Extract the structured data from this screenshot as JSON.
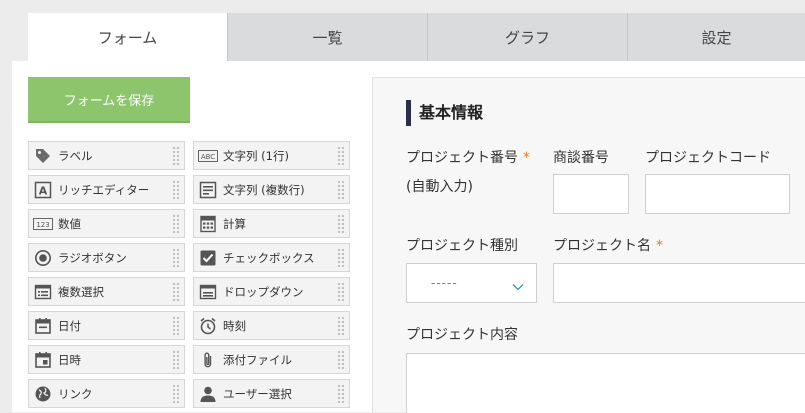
{
  "tabs": [
    {
      "label": "フォーム",
      "active": true
    },
    {
      "label": "一覧"
    },
    {
      "label": "グラフ"
    },
    {
      "label": "設定"
    }
  ],
  "palette": {
    "save_label": "フォームを保存",
    "items": [
      {
        "label": "ラベル",
        "icon": "tag-icon"
      },
      {
        "label": "文字列 (1行)",
        "icon": "abc-icon"
      },
      {
        "label": "リッチエディター",
        "icon": "rich-text-icon"
      },
      {
        "label": "文字列 (複数行)",
        "icon": "multiline-text-icon"
      },
      {
        "label": "数値",
        "icon": "number-icon"
      },
      {
        "label": "計算",
        "icon": "calculator-icon"
      },
      {
        "label": "ラジオボタン",
        "icon": "radio-icon"
      },
      {
        "label": "チェックボックス",
        "icon": "checkbox-icon"
      },
      {
        "label": "複数選択",
        "icon": "multi-select-icon"
      },
      {
        "label": "ドロップダウン",
        "icon": "dropdown-icon"
      },
      {
        "label": "日付",
        "icon": "calendar-icon"
      },
      {
        "label": "時刻",
        "icon": "clock-icon"
      },
      {
        "label": "日時",
        "icon": "datetime-icon"
      },
      {
        "label": "添付ファイル",
        "icon": "paperclip-icon"
      },
      {
        "label": "リンク",
        "icon": "globe-icon"
      },
      {
        "label": "ユーザー選択",
        "icon": "user-icon"
      }
    ]
  },
  "form": {
    "section_title": "基本情報",
    "project_number_label": "プロジェクト番号",
    "project_number_note": "(自動入力)",
    "deal_number_label": "商談番号",
    "project_code_label": "プロジェクトコード",
    "project_type_label": "プロジェクト種別",
    "project_type_value": "-----",
    "project_name_label": "プロジェクト名",
    "project_content_label": "プロジェクト内容",
    "required_mark": "*"
  },
  "colors": {
    "accent_green": "#8cc56b",
    "required_orange": "#e87e16",
    "section_bar": "#2a2f4e"
  }
}
